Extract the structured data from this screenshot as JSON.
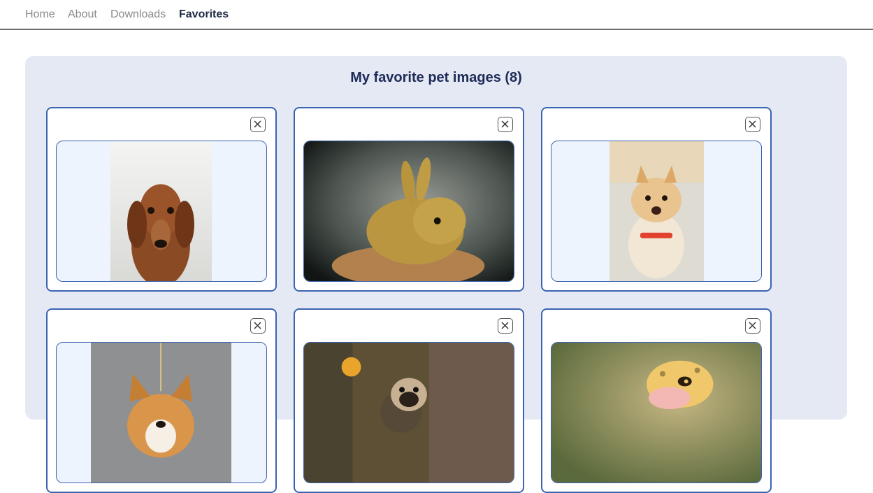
{
  "nav": {
    "links": [
      {
        "label": "Home",
        "active": false
      },
      {
        "label": "About",
        "active": false
      },
      {
        "label": "Downloads",
        "active": false
      },
      {
        "label": "Favorites",
        "active": true
      }
    ]
  },
  "favorites": {
    "title": "My favorite pet images (8)",
    "items": [
      {
        "subject": "dachshund",
        "remove_icon": "close-icon"
      },
      {
        "subject": "rabbit",
        "remove_icon": "close-icon"
      },
      {
        "subject": "pomeranian",
        "remove_icon": "close-icon"
      },
      {
        "subject": "corgi",
        "remove_icon": "close-icon"
      },
      {
        "subject": "pug",
        "remove_icon": "close-icon"
      },
      {
        "subject": "gecko",
        "remove_icon": "close-icon"
      }
    ]
  },
  "colors": {
    "accent": "#3c64b1",
    "panel_bg": "#e4e9f4",
    "title": "#1e2b57"
  }
}
